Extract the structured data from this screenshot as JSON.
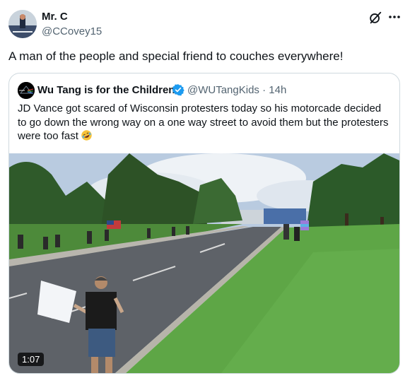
{
  "post": {
    "author_name": "Mr. C",
    "author_handle": "@CCovey15",
    "text": "A man of the people and special friend to couches everywhere!"
  },
  "quoted": {
    "name": "Wu Tang is for the Children",
    "handle_time": "@WUTangKids · 14h",
    "text": "JD Vance got scared of Wisconsin protesters today so his motorcade decided to go down the wrong way on a one way street to avoid them but the protesters were too fast",
    "emoji": "rolling-on-floor-laughing-emoji"
  },
  "video": {
    "duration": "1:07"
  },
  "icons": {
    "grok": "grok-icon",
    "more": "more-icon",
    "verified": "verified-badge-icon"
  },
  "colors": {
    "verified": "#1d9bf0",
    "secondary_text": "#536471",
    "border": "#cfd9de"
  }
}
